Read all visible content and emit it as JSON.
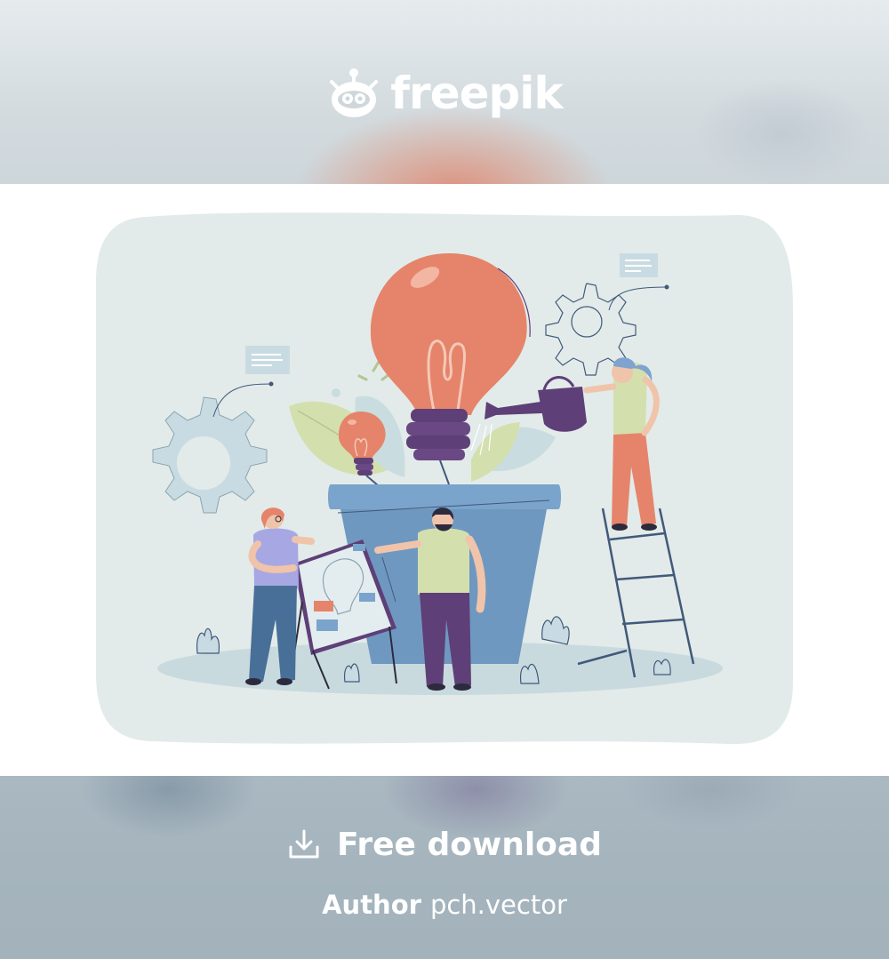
{
  "brand": {
    "name": "freepik",
    "logo_icon": "freepik-mascot-icon"
  },
  "illustration": {
    "subject": "team growing idea lightbulb in flower pot",
    "colors": {
      "background_blob": "#e2ebe9",
      "ground": "#c9dadf",
      "pot": "#6f98c0",
      "bulb": "#e5846a",
      "purple": "#5e3f77",
      "leaf_green": "#d4dfae",
      "gear": "#c9dbe2"
    }
  },
  "footer": {
    "download_label": "Free download",
    "download_icon": "download-icon",
    "author_key": "Author",
    "author_value": "pch.vector"
  }
}
